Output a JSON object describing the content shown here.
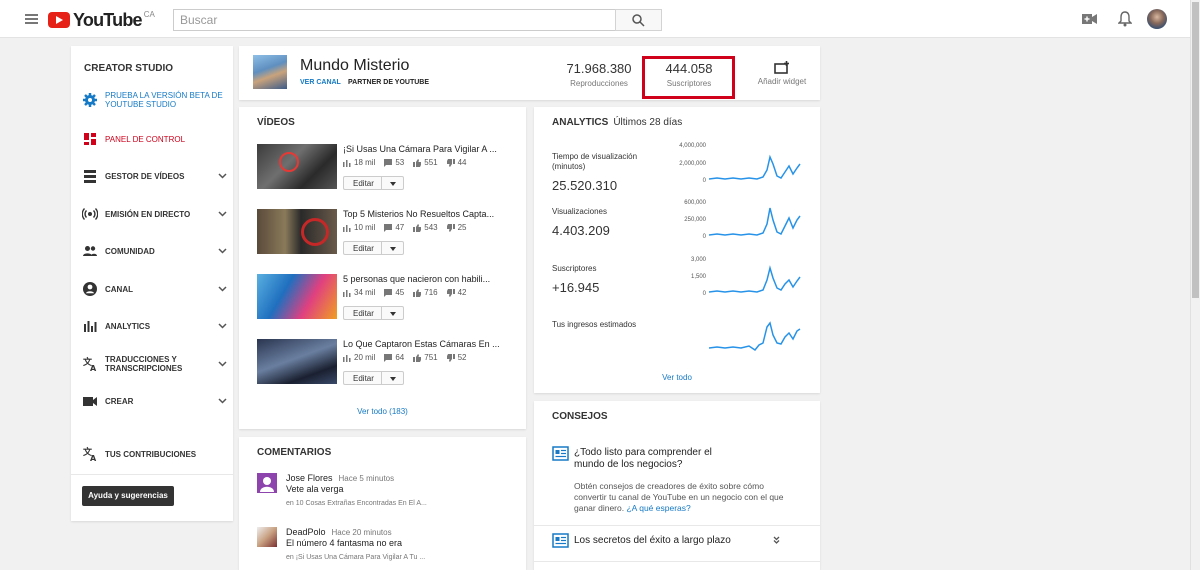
{
  "header": {
    "logo_text": "YouTube",
    "region": "CA",
    "search_placeholder": "Buscar"
  },
  "sidebar": {
    "title": "CREATOR STUDIO",
    "beta": "PRUEBA LA VERSIÓN BETA DE YOUTUBE STUDIO",
    "items": [
      {
        "label": "PANEL DE CONTROL",
        "active": true
      },
      {
        "label": "GESTOR DE VÍDEOS"
      },
      {
        "label": "EMISIÓN EN DIRECTO"
      },
      {
        "label": "COMUNIDAD"
      },
      {
        "label": "CANAL"
      },
      {
        "label": "ANALYTICS"
      },
      {
        "label": "TRADUCCIONES Y TRANSCRIPCIONES"
      },
      {
        "label": "CREAR"
      },
      {
        "label": "TUS CONTRIBUCIONES"
      }
    ],
    "help_button": "Ayuda y sugerencias"
  },
  "channel": {
    "name": "Mundo Misterio",
    "view_channel": "VER CANAL",
    "partner": "PARTNER DE YOUTUBE",
    "views_value": "71.968.380",
    "views_label": "Reproducciones",
    "subs_value": "444.058",
    "subs_label": "Suscriptores",
    "add_widget": "Añadir widget"
  },
  "videos": {
    "title": "VÍDEOS",
    "items": [
      {
        "title": "¡Si Usas Una Cámara Para Vigilar A ...",
        "views": "18 mil",
        "comments": "53",
        "likes": "551",
        "dislikes": "44",
        "edit": "Editar"
      },
      {
        "title": "Top 5 Misterios No Resueltos Capta...",
        "views": "10 mil",
        "comments": "47",
        "likes": "543",
        "dislikes": "25",
        "edit": "Editar"
      },
      {
        "title": "5 personas que nacieron con habili...",
        "views": "34 mil",
        "comments": "45",
        "likes": "716",
        "dislikes": "42",
        "edit": "Editar"
      },
      {
        "title": "Lo Que Captaron Estas Cámaras En ...",
        "views": "20 mil",
        "comments": "64",
        "likes": "751",
        "dislikes": "52",
        "edit": "Editar"
      }
    ],
    "see_all": "Ver todo (183)"
  },
  "analytics": {
    "title": "ANALYTICS",
    "period": "Últimos 28 días",
    "metrics": [
      {
        "label": "Tiempo de visualización (minutos)",
        "value": "25.520.310",
        "axis": [
          "4,000,000",
          "2,000,000",
          "0"
        ]
      },
      {
        "label": "Visualizaciones",
        "value": "4.403.209",
        "axis": [
          "600,000",
          "250,000",
          "0"
        ]
      },
      {
        "label": "Suscriptores",
        "value": "+16.945",
        "axis": [
          "3,000",
          "1,500",
          "0"
        ]
      },
      {
        "label": "Tus ingresos estimados",
        "value": "",
        "axis": []
      }
    ],
    "see_all": "Ver todo"
  },
  "comments": {
    "title": "COMENTARIOS",
    "items": [
      {
        "author": "Jose Flores",
        "time": "Hace 5 minutos",
        "text": "Vete ala verga",
        "ref": "en 10 Cosas Extrañas Encontradas En El A..."
      },
      {
        "author": "DeadPolo",
        "time": "Hace 20 minutos",
        "text": "El número 4 fantasma no era",
        "ref": "en ¡Si Usas Una Cámara Para Vigilar A Tu ..."
      }
    ]
  },
  "tips": {
    "title": "CONSEJOS",
    "heading": "¿Todo listo para comprender el mundo de los negocios?",
    "body": "Obtén consejos de creadores de éxito sobre cómo convertir tu canal de YouTube en un negocio con el que ganar dinero.",
    "link": "¿A qué esperas?",
    "item2": "Los secretos del éxito a largo plazo"
  },
  "colors": {
    "accent": "#167ac6",
    "brand": "#e62117",
    "highlight": "#d0021b",
    "sparkline": "#2793e8"
  }
}
